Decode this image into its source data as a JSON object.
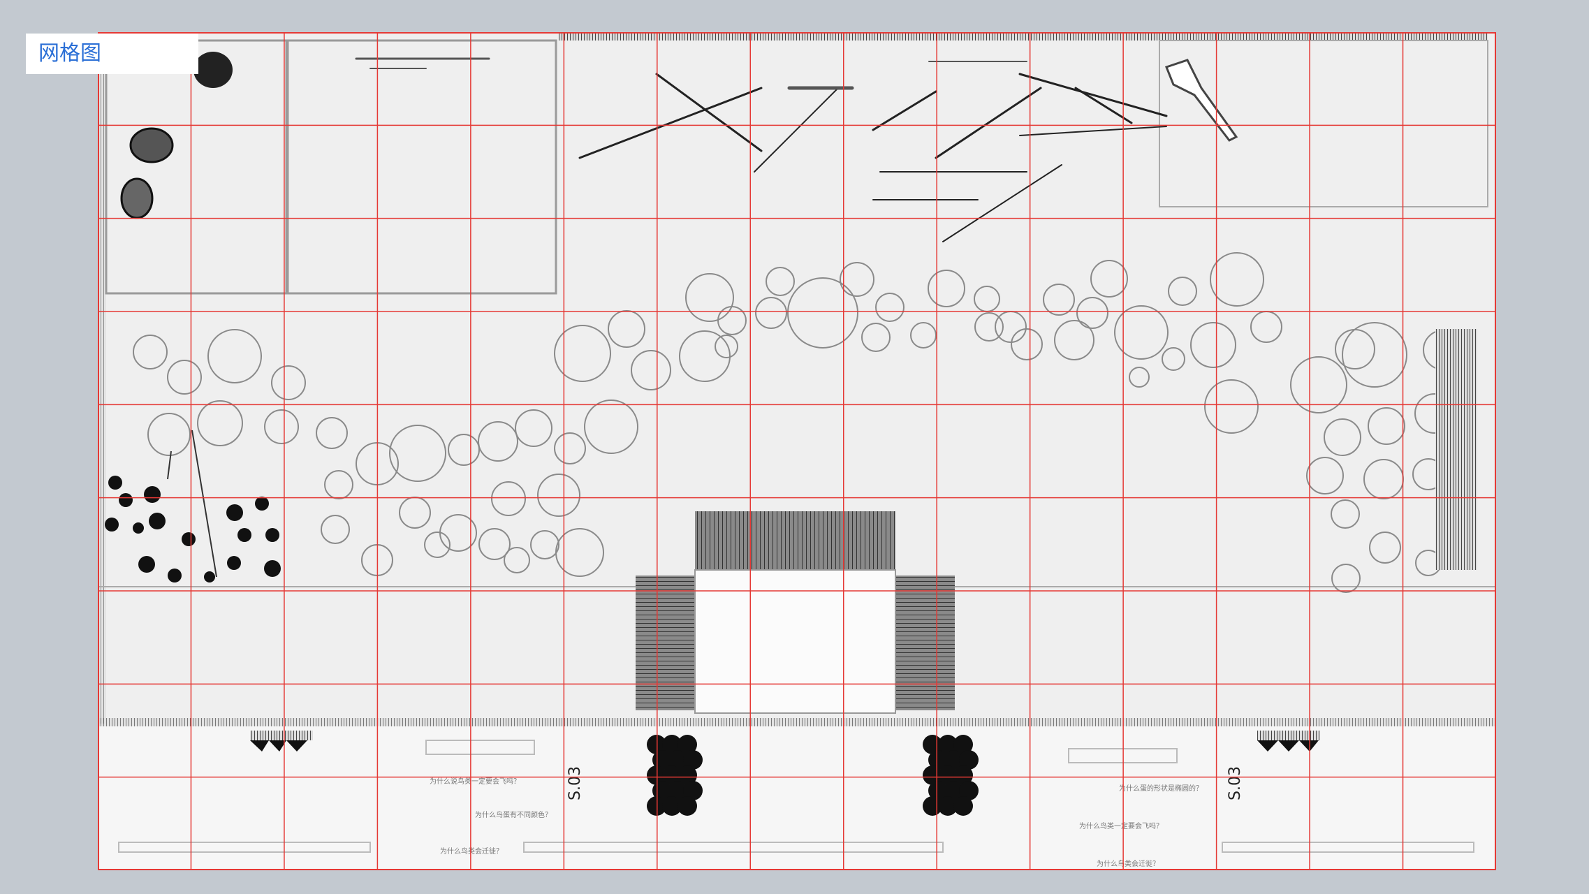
{
  "view_tab": {
    "label": "网格图"
  },
  "grid": {
    "color": "#e53935",
    "columns": 15,
    "rows": 9
  },
  "plan": {
    "south_labels": [
      "S.03",
      "S.03"
    ],
    "signs": [
      "为什么说鸟类一定要会飞吗？",
      "为什么鸟蛋有不同颜色？",
      "为什么鸟类会迁徙？",
      "为什么蛋的形状是椭圆的？",
      "为什么鸟类一定要会飞吗？",
      "为什么鸟类会迁徙？"
    ]
  }
}
